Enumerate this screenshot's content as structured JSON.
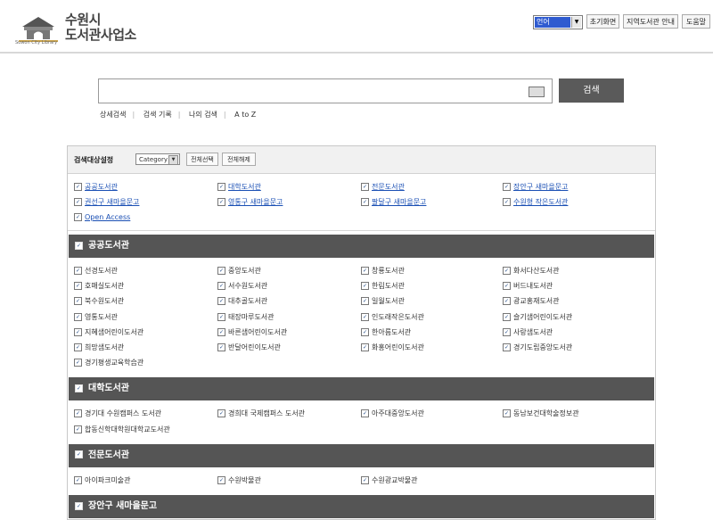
{
  "header": {
    "logo_title_line1": "수원시",
    "logo_title_line2": "도서관사업소",
    "logo_subtitle": "Suwon City Library",
    "language_select": "언어",
    "buttons": [
      "초기화면",
      "지역도서관 안내",
      "도움말"
    ]
  },
  "search": {
    "query": "",
    "submit_label": "검색",
    "links": [
      "상세검색",
      "검색 기록",
      "나의 검색",
      "A to Z"
    ]
  },
  "panel": {
    "title": "검색대상설정",
    "category_select": "Category",
    "select_all": "전체선택",
    "deselect_all": "전체해제",
    "targets": [
      [
        "공공도서관",
        "대학도서관",
        "전문도서관",
        "장안구 새마을문고"
      ],
      [
        "권선구 새마을문고",
        "영통구 새마을문고",
        "팔달구 새마을문고",
        "수원형 작은도서관"
      ],
      [
        "Open Access"
      ]
    ],
    "sections": [
      {
        "title": "공공도서관",
        "rows": [
          [
            "선경도서관",
            "중앙도서관",
            "창룡도서관",
            "화서다산도서관"
          ],
          [
            "호매실도서관",
            "서수원도서관",
            "한림도서관",
            "버드내도서관"
          ],
          [
            "북수원도서관",
            "대추골도서관",
            "일월도서관",
            "광교홍재도서관"
          ],
          [
            "영통도서관",
            "태장마루도서관",
            "인도래작은도서관",
            "슬기샘어린이도서관"
          ],
          [
            "지혜샘어린이도서관",
            "바른샘어린이도서관",
            "한아름도서관",
            "사랑샘도서관"
          ],
          [
            "희망샘도서관",
            "반달어린이도서관",
            "화홍어린이도서관",
            "경기도립중앙도서관"
          ],
          [
            "경기평생교육학습관"
          ]
        ]
      },
      {
        "title": "대학도서관",
        "rows": [
          [
            "경기대 수원캠퍼스 도서관",
            "경희대 국제캠퍼스 도서관",
            "아주대중앙도서관",
            "동남보건대학술정보관"
          ],
          [
            "합동신학대학원대학교도서관"
          ]
        ]
      },
      {
        "title": "전문도서관",
        "rows": [
          [
            "아이파크미술관",
            "수원박물관",
            "수원광교박물관"
          ]
        ]
      },
      {
        "title": "장안구 새마을문고",
        "rows": []
      }
    ]
  }
}
